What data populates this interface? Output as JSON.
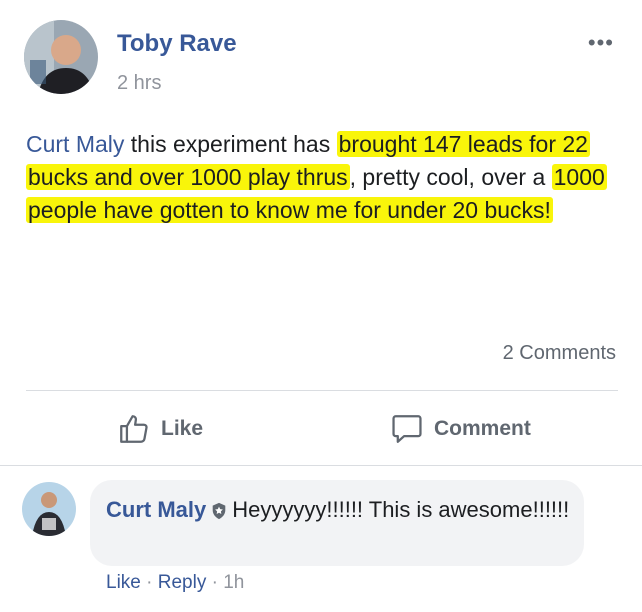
{
  "post": {
    "author": "Toby Rave",
    "time": "2 hrs",
    "more_label": "•••",
    "text": {
      "mention": "Curt Maly",
      "part1": " this experiment has ",
      "hl1": "brought 147 leads for 22 bucks and over 1000 play thrus",
      "part2": ", pretty cool, over a ",
      "hl2": "1000 people have gotten to know me for under 20 bucks!"
    },
    "comments_count": "2 Comments"
  },
  "actions": {
    "like_label": "Like",
    "comment_label": "Comment"
  },
  "comment": {
    "author": "Curt Maly",
    "text": "Heyyyyyy!!!!!! This is awesome!!!!!!",
    "like_label": "Like",
    "sep1": " · ",
    "reply_label": "Reply",
    "sep2": " · ",
    "time": "1h"
  },
  "colors": {
    "link": "#385898",
    "highlight": "#f9f50a",
    "muted": "#606770",
    "bubble": "#f2f3f5"
  },
  "icons": {
    "like": "thumbs-up-icon",
    "comment": "speech-bubble-icon",
    "more": "more-dots-icon",
    "badge": "verified-badge-icon"
  }
}
